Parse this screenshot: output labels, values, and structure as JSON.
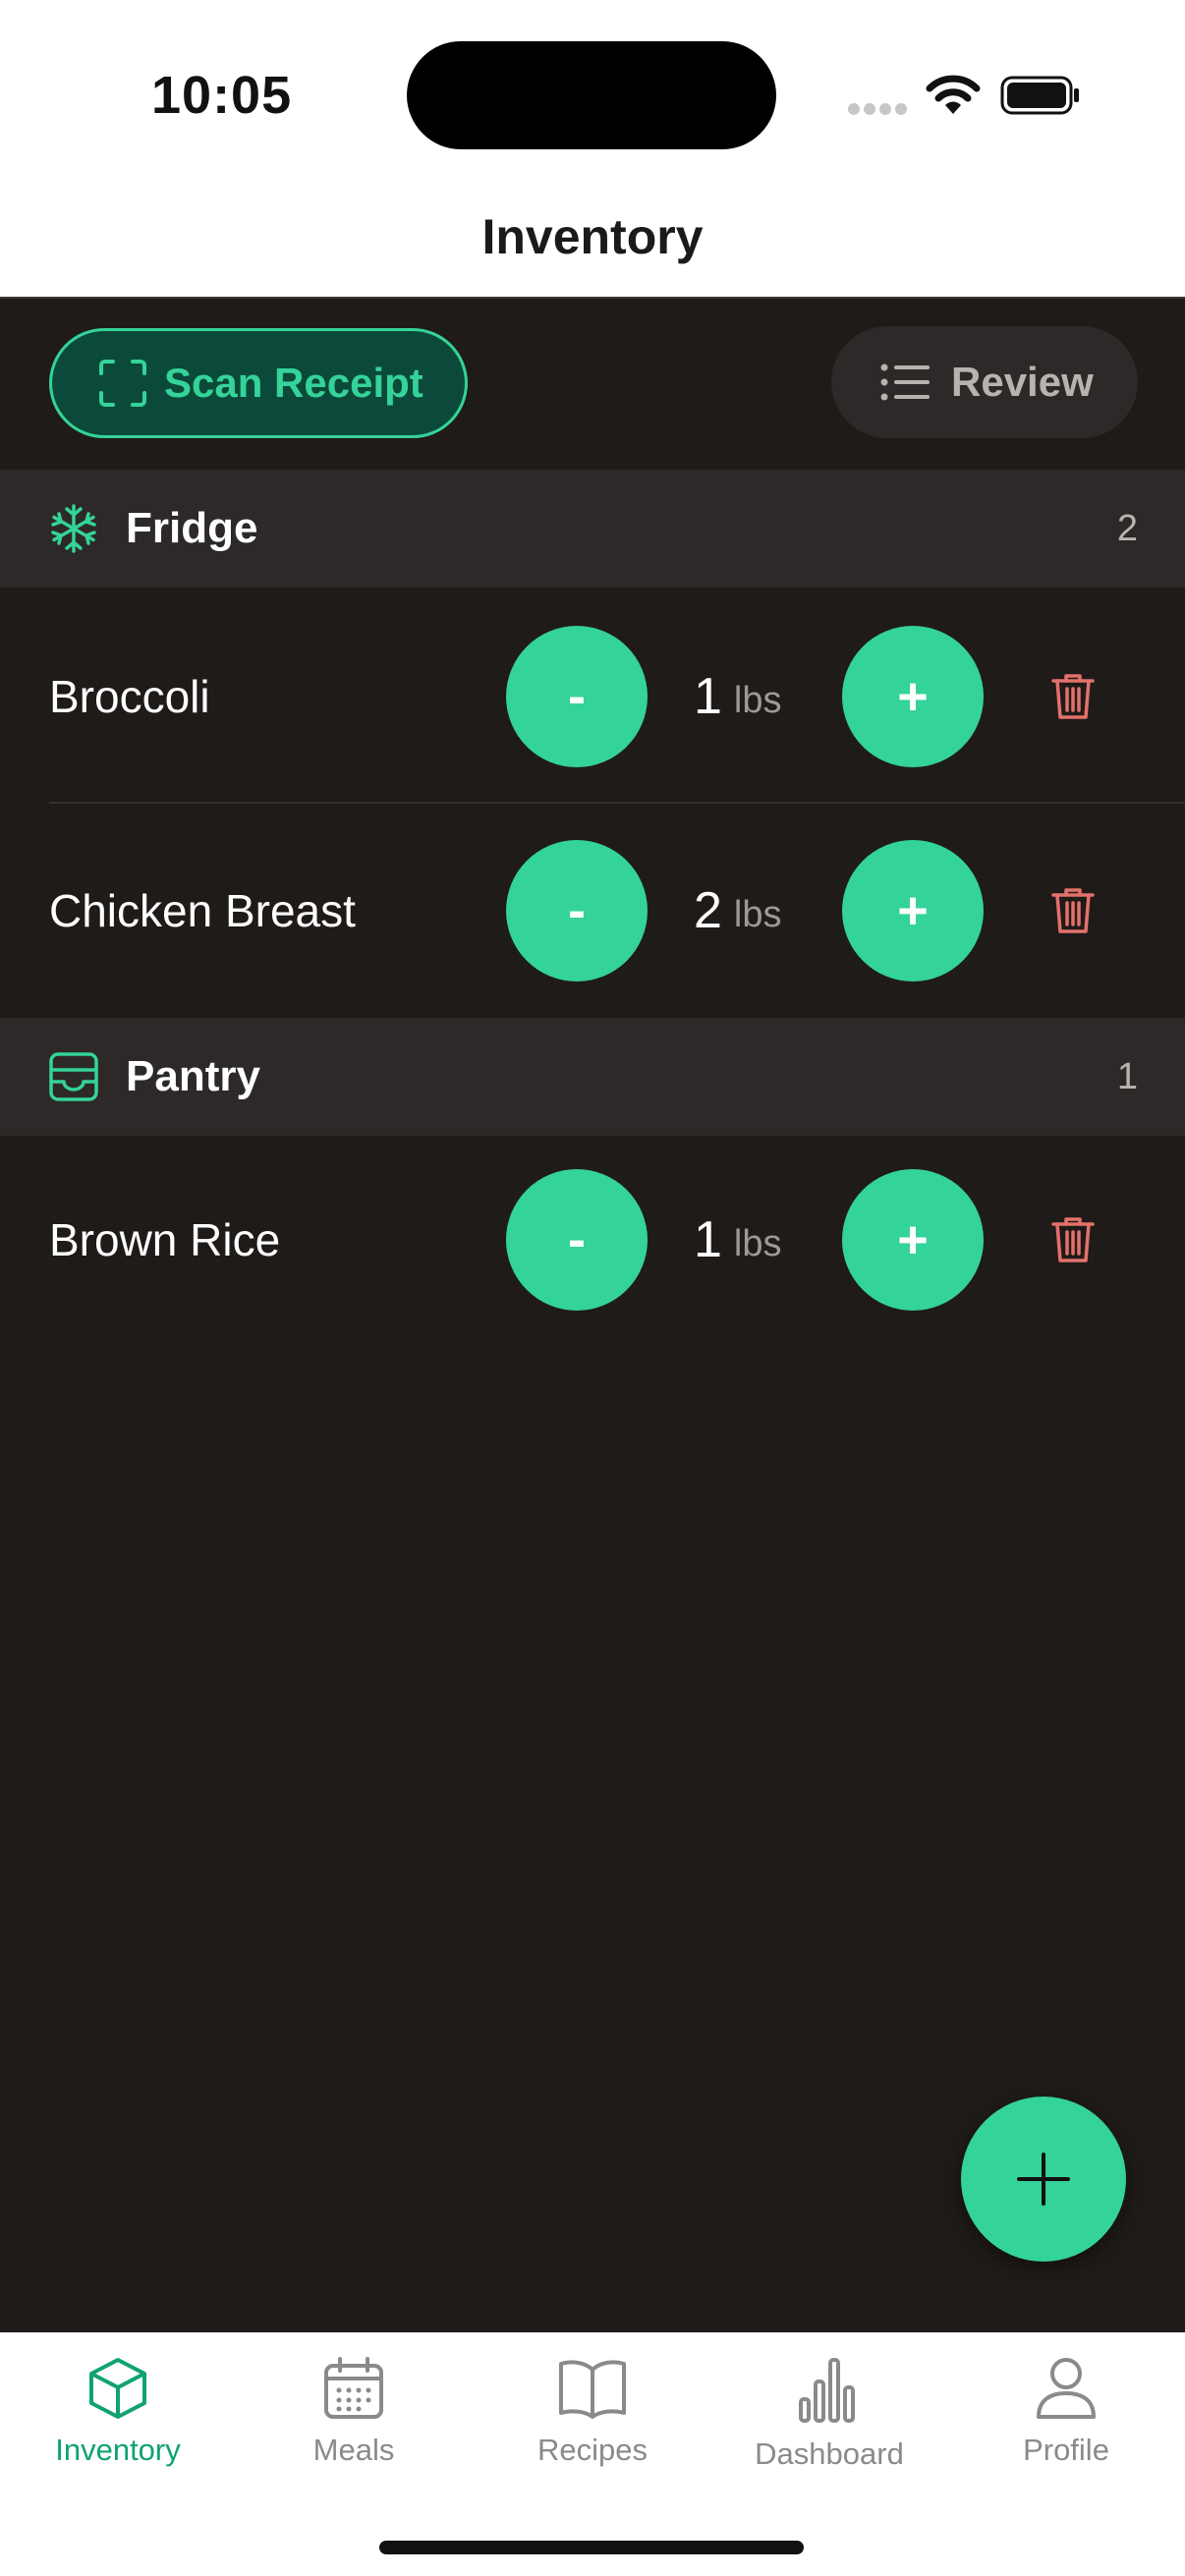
{
  "status": {
    "time": "10:05"
  },
  "header": {
    "title": "Inventory"
  },
  "toolbar": {
    "scan_label": "Scan Receipt",
    "review_label": "Review"
  },
  "sections": [
    {
      "name": "Fridge",
      "count": "2",
      "icon": "snowflake-icon",
      "items": [
        {
          "name": "Broccoli",
          "qty": "1",
          "unit": "lbs"
        },
        {
          "name": "Chicken Breast",
          "qty": "2",
          "unit": "lbs"
        }
      ]
    },
    {
      "name": "Pantry",
      "count": "1",
      "icon": "tray-icon",
      "items": [
        {
          "name": "Brown Rice",
          "qty": "1",
          "unit": "lbs"
        }
      ]
    }
  ],
  "controls": {
    "minus": "-",
    "plus": "+"
  },
  "tabs": [
    {
      "label": "Inventory",
      "icon": "cube-icon",
      "active": true
    },
    {
      "label": "Meals",
      "icon": "calendar-icon"
    },
    {
      "label": "Recipes",
      "icon": "book-icon"
    },
    {
      "label": "Dashboard",
      "icon": "bar-chart-icon"
    },
    {
      "label": "Profile",
      "icon": "person-icon"
    }
  ],
  "colors": {
    "accent": "#34d399",
    "background": "#1f1b19",
    "section": "#2c2928",
    "danger": "#e4716b"
  }
}
